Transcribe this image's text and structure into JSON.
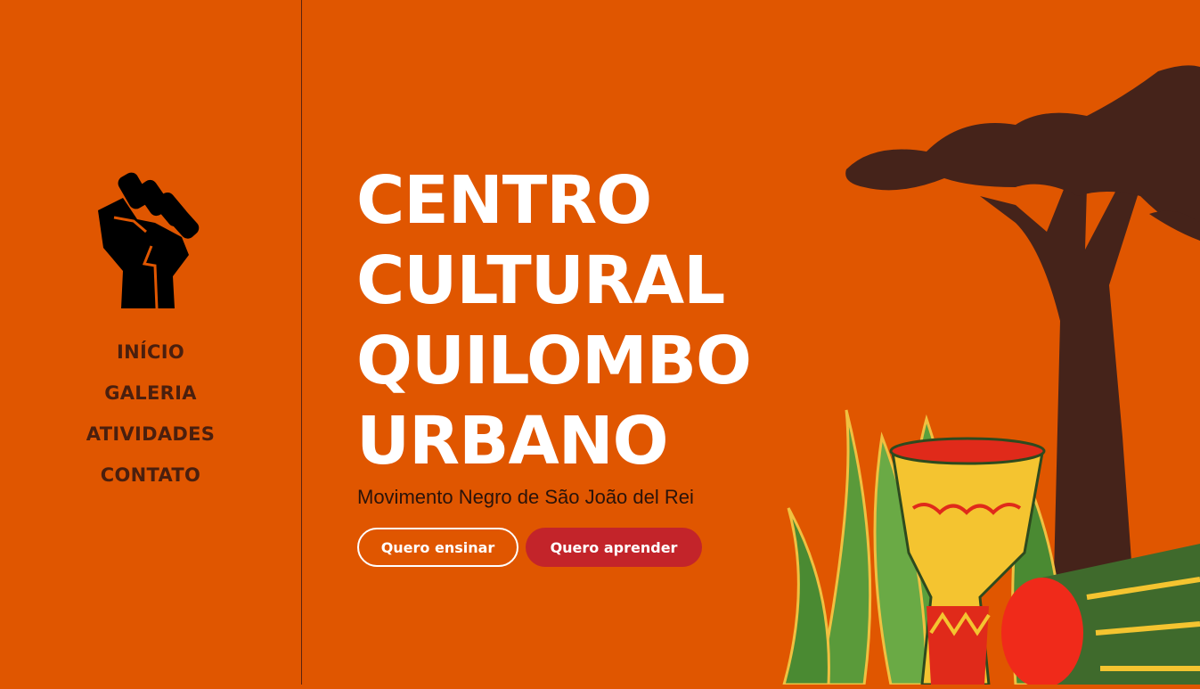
{
  "nav": {
    "items": [
      "INÍCIO",
      "GALERIA",
      "ATIVIDADES",
      "CONTATO"
    ]
  },
  "hero": {
    "title_lines": [
      "CENTRO",
      "CULTURAL",
      "QUILOMBO",
      "URBANO"
    ],
    "subtitle": "Movimento Negro de São João del Rei",
    "buttons": {
      "teach": "Quero ensinar",
      "learn": "Quero aprender"
    }
  },
  "colors": {
    "background": "#e05600",
    "nav_text": "#4a1f0e",
    "title": "#ffffff",
    "primary_button": "#c3242a",
    "tree": "#45231a"
  },
  "icons": {
    "logo": "raised-fist-icon"
  }
}
